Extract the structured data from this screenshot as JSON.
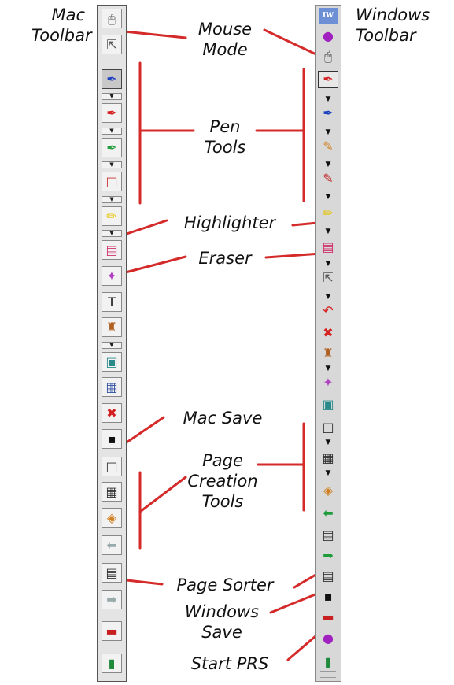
{
  "labels": {
    "mac_toolbar": [
      "Mac",
      "Toolbar"
    ],
    "windows_toolbar": [
      "Windows",
      "Toolbar"
    ],
    "mouse_mode": [
      "Mouse",
      "Mode"
    ],
    "pen_tools": [
      "Pen",
      "Tools"
    ],
    "highlighter": "Highlighter",
    "eraser": "Eraser",
    "mac_save": "Mac Save",
    "page_creation_tools": [
      "Page",
      "Creation",
      "Tools"
    ],
    "page_sorter": "Page Sorter",
    "windows_save": [
      "Windows",
      "Save"
    ],
    "start_prs": "Start PRS"
  },
  "windows_logo": "IW",
  "colors": {
    "leader_line": "#d42a2a",
    "mac_toolbar_bg": "#e4e4e4",
    "win_toolbar_bg": "#d8d8d8",
    "logo_bg": "#6c8fd6"
  },
  "mac_buttons": [
    {
      "icon": "mouse-icon",
      "glyph": "🖱"
    },
    {
      "icon": "pointer-icon",
      "glyph": "⇱"
    },
    {
      "icon": "pen-blue-icon",
      "glyph": "✒"
    },
    {
      "icon": "pen-red-icon",
      "glyph": "✒"
    },
    {
      "icon": "pen-green-icon",
      "glyph": "✒"
    },
    {
      "icon": "rectangle-tool-icon",
      "glyph": "□"
    },
    {
      "icon": "highlighter-icon",
      "glyph": "✏"
    },
    {
      "icon": "eraser-icon",
      "glyph": "▤"
    },
    {
      "icon": "spotlight-icon",
      "glyph": "✦"
    },
    {
      "icon": "text-tool-icon",
      "glyph": "T"
    },
    {
      "icon": "stamp-icon",
      "glyph": "♜"
    },
    {
      "icon": "picture-frame-icon",
      "glyph": "▣"
    },
    {
      "icon": "calendar-grid-icon",
      "glyph": "▦"
    },
    {
      "icon": "clear-page-icon",
      "glyph": "✖"
    },
    {
      "icon": "save-floppy-icon",
      "glyph": "▪"
    },
    {
      "icon": "blank-page-icon",
      "glyph": "□"
    },
    {
      "icon": "grid-page-icon",
      "glyph": "▦"
    },
    {
      "icon": "image-page-icon",
      "glyph": "◈"
    },
    {
      "icon": "back-arrow-icon",
      "glyph": "⬅"
    },
    {
      "icon": "page-sorter-icon",
      "glyph": "▤"
    },
    {
      "icon": "forward-arrow-icon",
      "glyph": "➡"
    },
    {
      "icon": "toolbox-icon",
      "glyph": "▬"
    },
    {
      "icon": "exit-door-icon",
      "glyph": "▮"
    }
  ],
  "win_buttons": [
    {
      "icon": "start-prs-small-icon",
      "glyph": "●"
    },
    {
      "icon": "mouse-icon",
      "glyph": "🖱"
    },
    {
      "icon": "pen-red-selected-icon",
      "glyph": "✒"
    },
    {
      "icon": "pen-blue-icon",
      "glyph": "✒"
    },
    {
      "icon": "pen-striped-icon",
      "glyph": "✎"
    },
    {
      "icon": "pen-dotted-icon",
      "glyph": "✎"
    },
    {
      "icon": "highlighter-icon",
      "glyph": "✏"
    },
    {
      "icon": "eraser-icon",
      "glyph": "▤"
    },
    {
      "icon": "pointer-icon",
      "glyph": "⇱"
    },
    {
      "icon": "undo-icon",
      "glyph": "↶"
    },
    {
      "icon": "clear-page-icon",
      "glyph": "✖"
    },
    {
      "icon": "stamp-icon",
      "glyph": "♜"
    },
    {
      "icon": "spotlight-icon",
      "glyph": "✦"
    },
    {
      "icon": "picture-frame-icon",
      "glyph": "▣"
    },
    {
      "icon": "blank-page-icon",
      "glyph": "□"
    },
    {
      "icon": "grid-page-icon",
      "glyph": "▦"
    },
    {
      "icon": "image-page-icon",
      "glyph": "◈"
    },
    {
      "icon": "back-arrow-icon",
      "glyph": "⬅"
    },
    {
      "icon": "page-sorter-small-icon",
      "glyph": "▤"
    },
    {
      "icon": "forward-arrow-icon",
      "glyph": "➡"
    },
    {
      "icon": "page-sorter-icon",
      "glyph": "▤"
    },
    {
      "icon": "save-floppy-icon",
      "glyph": "▪"
    },
    {
      "icon": "toolbox-icon",
      "glyph": "▬"
    },
    {
      "icon": "start-prs-icon",
      "glyph": "●"
    },
    {
      "icon": "exit-door-icon",
      "glyph": "▮"
    }
  ]
}
